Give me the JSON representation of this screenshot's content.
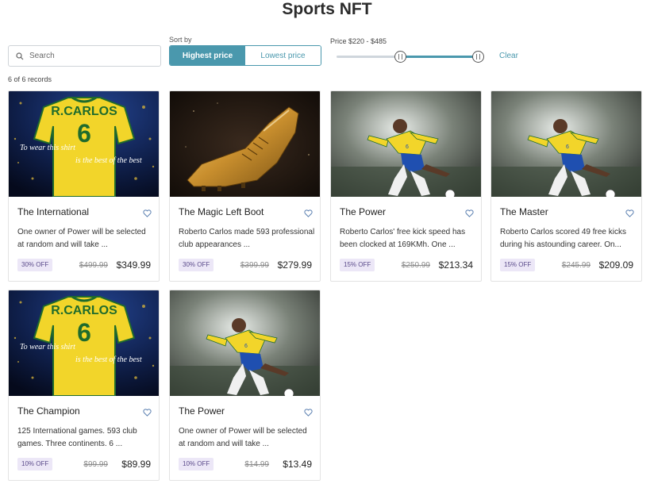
{
  "page": {
    "title": "Sports NFT"
  },
  "search": {
    "placeholder": "Search",
    "value": ""
  },
  "sort": {
    "label": "Sort by",
    "options": [
      "Highest price",
      "Lowest price"
    ],
    "selected": "Highest price"
  },
  "price_filter": {
    "label": "Price $220 - $485",
    "range_low_fraction": 0.45,
    "range_high_fraction": 1.0,
    "clear_label": "Clear"
  },
  "colors": {
    "accent": "#4a98ad",
    "badge_bg": "#ece7f7",
    "badge_text": "#5a4a8a"
  },
  "records_text": "6 of 6 records",
  "cards": [
    {
      "name": "The International",
      "description": "One owner of Power will be selected at random and will take ...",
      "discount": "30% OFF",
      "old_price": "$499.99",
      "price": "$349.99",
      "image": "jersey",
      "heart_icon": "heart-outline-icon"
    },
    {
      "name": "The Magic Left Boot",
      "description": "Roberto Carlos made 593 professional club appearances ...",
      "discount": "30% OFF",
      "old_price": "$399.99",
      "price": "$279.99",
      "image": "golden-boot",
      "heart_icon": "heart-outline-icon"
    },
    {
      "name": "The Power",
      "description": "Roberto Carlos' free kick speed has been clocked at 169KMh. One ...",
      "discount": "15% OFF",
      "old_price": "$250.99",
      "price": "$213.34",
      "image": "player-kick",
      "heart_icon": "heart-outline-icon"
    },
    {
      "name": "The Master",
      "description": "Roberto Carlos scored 49 free kicks during his astounding career. On...",
      "discount": "15% OFF",
      "old_price": "$245.99",
      "price": "$209.09",
      "image": "player-kick",
      "heart_icon": "heart-outline-icon"
    },
    {
      "name": "The Champion",
      "description": "125 International games. 593 club games. Three continents. 6 ...",
      "discount": "10% OFF",
      "old_price": "$99.99",
      "price": "$89.99",
      "image": "jersey",
      "heart_icon": "heart-outline-icon"
    },
    {
      "name": "The Power",
      "description": "One owner of Power will be selected at random and will take ...",
      "discount": "10% OFF",
      "old_price": "$14.99",
      "price": "$13.49",
      "image": "player-kick",
      "heart_icon": "heart-outline-icon"
    }
  ],
  "image_text": {
    "jersey_name": "R.CARLOS",
    "jersey_number": "6",
    "jersey_caption_1": "To wear this shirt",
    "jersey_caption_2": "is the best of the best"
  }
}
